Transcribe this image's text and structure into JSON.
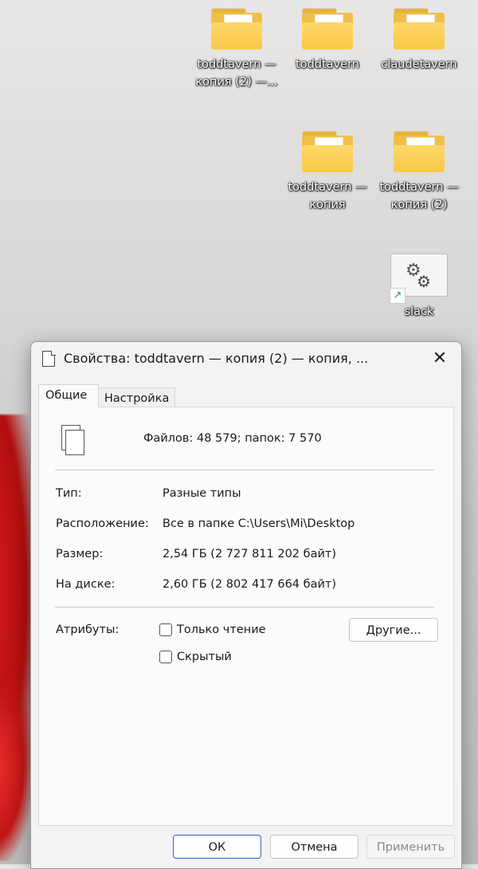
{
  "desktop": {
    "icons": [
      {
        "label_line1": "toddtavern —",
        "label_line2": "копия (2) —..."
      },
      {
        "label_line1": "toddtavern",
        "label_line2": ""
      },
      {
        "label_line1": "claudetavern",
        "label_line2": ""
      },
      {
        "label_line1": "toddtavern —",
        "label_line2": "копия"
      },
      {
        "label_line1": "toddtavern —",
        "label_line2": "копия (2)"
      },
      {
        "label_line1": "slack",
        "label_line2": ""
      }
    ]
  },
  "dialog": {
    "title": "Свойства: toddtavern — копия (2) — копия, ...",
    "close_glyph": "✕",
    "tabs": [
      {
        "label": "Общие",
        "active": true
      },
      {
        "label": "Настройка",
        "active": false
      }
    ],
    "summary": "Файлов: 48 579; папок: 7 570",
    "properties": [
      {
        "label": "Тип:",
        "value": "Разные типы"
      },
      {
        "label": "Расположение:",
        "value": "Все в папке C:\\Users\\Mi\\Desktop"
      },
      {
        "label": "Размер:",
        "value": "2,54 ГБ (2 727 811 202 байт)"
      },
      {
        "label": "На диске:",
        "value": "2,60 ГБ (2 802 417 664 байт)"
      }
    ],
    "attributes_label": "Атрибуты:",
    "attributes": [
      {
        "label": "Только чтение",
        "checked": false
      },
      {
        "label": "Скрытый",
        "checked": false
      }
    ],
    "other_button": "Другие...",
    "buttons": {
      "ok": "ОК",
      "cancel": "Отмена",
      "apply": "Применить"
    }
  }
}
